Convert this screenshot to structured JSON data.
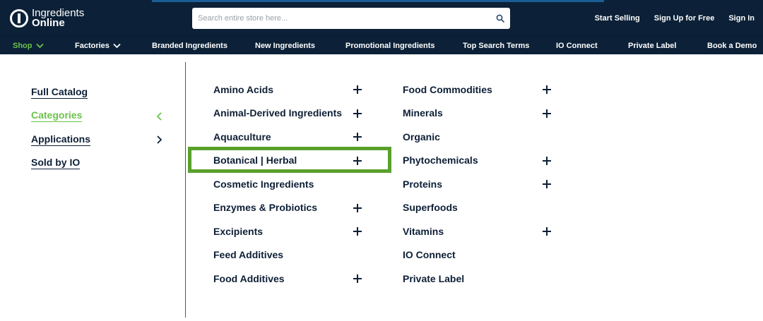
{
  "header": {
    "logo": {
      "line1": "Ingredients",
      "line2": "Online"
    },
    "search": {
      "placeholder": "Search entire store here..."
    },
    "links": [
      "Start Selling",
      "Sign Up for Free",
      "Sign In"
    ]
  },
  "nav": {
    "items": [
      {
        "label": "Shop",
        "active": true,
        "dropdown": true
      },
      {
        "label": "Factories",
        "active": false,
        "dropdown": true
      },
      {
        "label": "Branded Ingredients"
      },
      {
        "label": "New Ingredients"
      },
      {
        "label": "Promotional Ingredients"
      },
      {
        "label": "Top Search Terms"
      },
      {
        "label": "IO Connect"
      },
      {
        "label": "Private Label"
      },
      {
        "label": "Book a Demo"
      }
    ]
  },
  "menu": {
    "left": [
      {
        "label": "Full Catalog",
        "active": false,
        "arrow": ""
      },
      {
        "label": "Categories",
        "active": true,
        "arrow": "chevron-left"
      },
      {
        "label": "Applications",
        "active": false,
        "arrow": "chevron-right"
      },
      {
        "label": "Sold by IO",
        "active": false,
        "arrow": ""
      }
    ],
    "col1": [
      {
        "label": "Amino Acids",
        "expandable": true
      },
      {
        "label": "Animal-Derived Ingredients",
        "expandable": true
      },
      {
        "label": "Aquaculture",
        "expandable": true
      },
      {
        "label": "Botanical | Herbal",
        "expandable": true
      },
      {
        "label": "Cosmetic Ingredients",
        "expandable": false
      },
      {
        "label": "Enzymes & Probiotics",
        "expandable": true
      },
      {
        "label": "Excipients",
        "expandable": true
      },
      {
        "label": "Feed Additives",
        "expandable": false
      },
      {
        "label": "Food Additives",
        "expandable": true
      }
    ],
    "col2": [
      {
        "label": "Food Commodities",
        "expandable": true
      },
      {
        "label": "Minerals",
        "expandable": true
      },
      {
        "label": "Organic",
        "expandable": false
      },
      {
        "label": "Phytochemicals",
        "expandable": true
      },
      {
        "label": "Proteins",
        "expandable": true
      },
      {
        "label": "Superfoods",
        "expandable": false
      },
      {
        "label": "Vitamins",
        "expandable": true
      },
      {
        "label": "IO Connect",
        "expandable": false
      },
      {
        "label": "Private Label",
        "expandable": false
      }
    ]
  },
  "colors": {
    "navy": "#0c2137",
    "green": "#6cc24a",
    "highlight": "#5aa02c"
  }
}
